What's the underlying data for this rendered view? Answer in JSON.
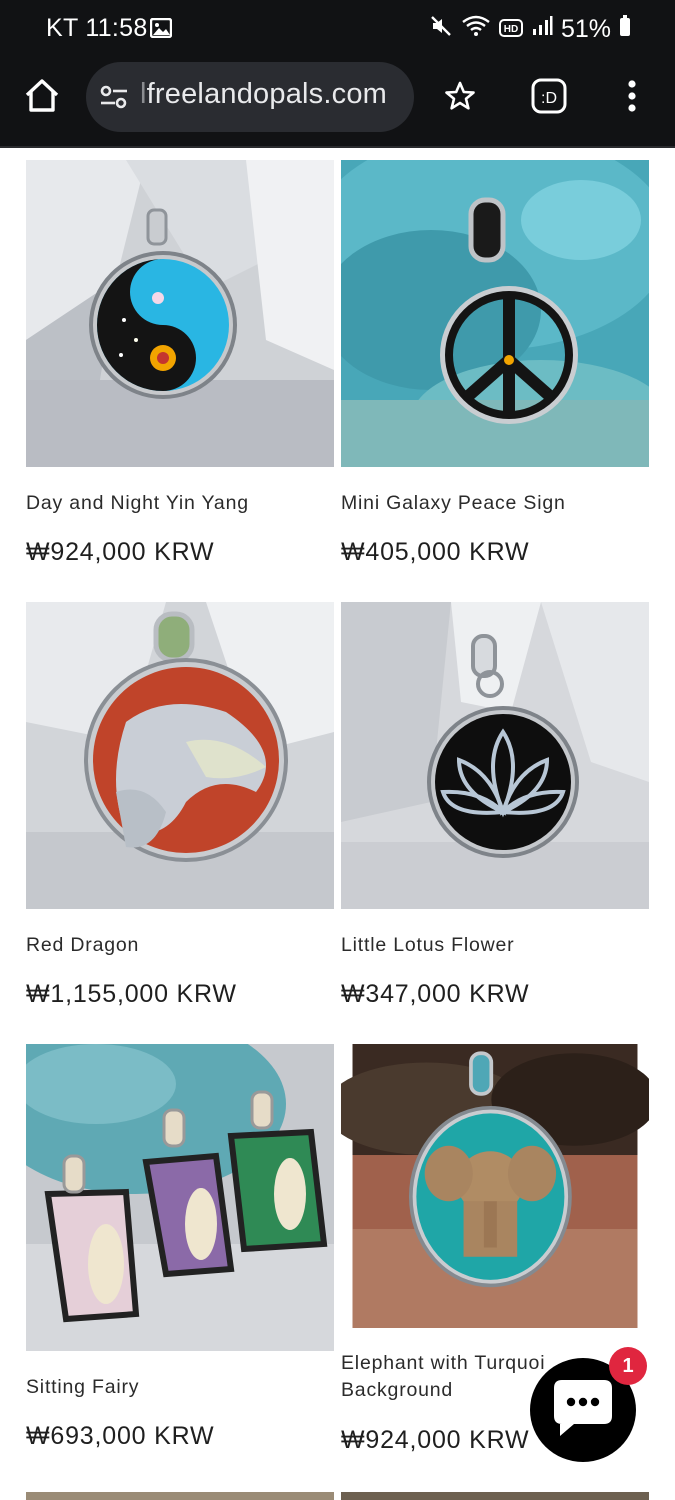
{
  "status": {
    "carrier_time": "KT 11:58",
    "battery": "51%",
    "icons": [
      "gallery-icon",
      "mute-icon",
      "wifi-icon",
      "hd-icon",
      "signal-icon",
      "battery-icon"
    ]
  },
  "browser": {
    "url": "freelandopals.com",
    "url_prefix_fade": "l",
    "icons": [
      "home-icon",
      "site-settings-icon",
      "star-icon",
      "extension-icon",
      "more-icon"
    ]
  },
  "products": [
    {
      "name": "Day and Night Yin Yang",
      "price": "₩924,000 KRW"
    },
    {
      "name": "Mini Galaxy Peace Sign",
      "price": "₩405,000 KRW"
    },
    {
      "name": "Red Dragon",
      "price": "₩1,155,000 KRW"
    },
    {
      "name": "Little Lotus Flower",
      "price": "₩347,000 KRW"
    },
    {
      "name": "Sitting Fairy",
      "price": "₩693,000 KRW"
    },
    {
      "name_line1": "Elephant with Turquoi",
      "name_line2": "Background",
      "price": "₩924,000 KRW"
    }
  ],
  "chat": {
    "unread": "1"
  },
  "colors": {
    "chrome_bg": "#111214",
    "urlbar_bg": "#2a2c31",
    "badge": "#e0263f"
  }
}
